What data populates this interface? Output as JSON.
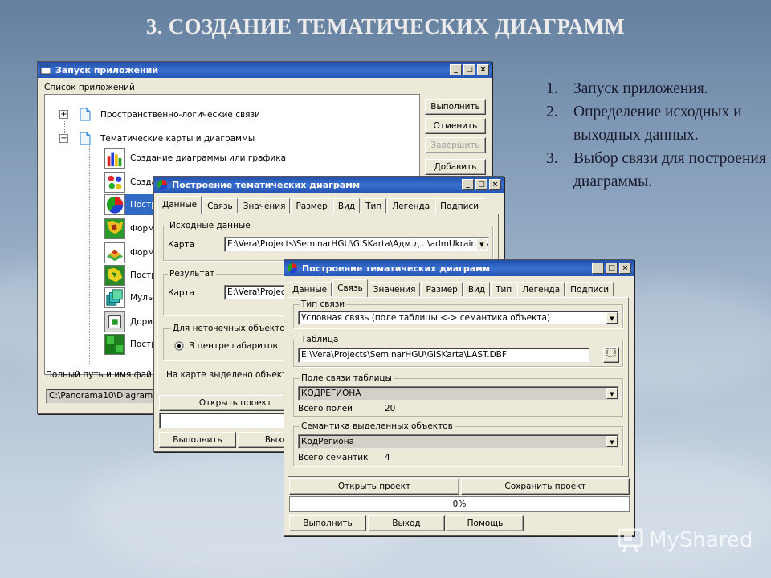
{
  "slide_title": "3. СОЗДАНИЕ ТЕМАТИЧЕСКИХ ДИАГРАММ",
  "notes": [
    {
      "num": "1.",
      "text": "Запуск приложения."
    },
    {
      "num": "2.",
      "text": "Определение исходных и выходных данных."
    },
    {
      "num": "3.",
      "text": "Выбор связи для построения диаграммы."
    }
  ],
  "watermark": "MyShared",
  "win1": {
    "title": "Запуск приложений",
    "list_label": "Список приложений",
    "tree": [
      {
        "label": "Пространственно-логические связи",
        "expander": "+"
      },
      {
        "label": "Тематические карты и диаграммы",
        "expander": "−"
      },
      {
        "label": "Создание диаграммы или графика"
      },
      {
        "label": "Создан"
      },
      {
        "label": "Постро"
      },
      {
        "label": "Форми"
      },
      {
        "label": "Форми"
      },
      {
        "label": "Постро"
      },
      {
        "label": "Мульти"
      },
      {
        "label": "Дорисо"
      },
      {
        "label": "Постро"
      }
    ],
    "buttons": {
      "run": "Выполнить",
      "cancel": "Отменить",
      "cancel2": "Завершить",
      "add": "Добавить"
    },
    "path_label": "Полный путь и имя файла *.dll",
    "path_value": "C:\\Panorama10\\Diagram.dll"
  },
  "win2": {
    "title": "Построение тематических диаграмм",
    "tabs": [
      "Данные",
      "Связь",
      "Значения",
      "Размер",
      "Вид",
      "Тип",
      "Легенда",
      "Подписи"
    ],
    "active_tab": 0,
    "group_source": "Исходные данные",
    "map_label": "Карта",
    "map_value": "E:\\Vera\\Projects\\SeminarHGU\\GISKarta\\Адм.д...\\admUkraine.M",
    "group_result": "Результат",
    "result_label": "Карта",
    "result_value": "E:\\Vera\\Project",
    "group_fuzzy": "Для неточечных объектов о",
    "radio_center": "В центре габаритов",
    "selected_label": "На карте выделено объектов",
    "open_btn": "Открыть проект",
    "run_btn": "Выполнить",
    "exit_btn": "Выхо"
  },
  "win3": {
    "title": "Построение тематических диаграмм",
    "tabs": [
      "Данные",
      "Связь",
      "Значения",
      "Размер",
      "Вид",
      "Тип",
      "Легенда",
      "Подписи"
    ],
    "active_tab": 1,
    "link_type_title": "Тип связи",
    "link_type_value": "Условная связь (поле таблицы <-> семантика объекта)",
    "table_title": "Таблица",
    "table_value": "E:\\Vera\\Projects\\SeminarHGU\\GISKarta\\LAST.DBF",
    "field_title": "Поле связи таблицы",
    "field_value": "КОДРЕГИОНА",
    "total_fields_label": "Всего полей",
    "total_fields_value": "20",
    "sem_title": "Семантика выделенных объектов",
    "sem_value": "КодРегиона",
    "total_sem_label": "Всего семантик",
    "total_sem_value": "4",
    "open_btn": "Открыть проект",
    "save_btn": "Сохранить проект",
    "progress": "0%",
    "run_btn": "Выполнить",
    "exit_btn": "Выход",
    "help_btn": "Помощь"
  }
}
